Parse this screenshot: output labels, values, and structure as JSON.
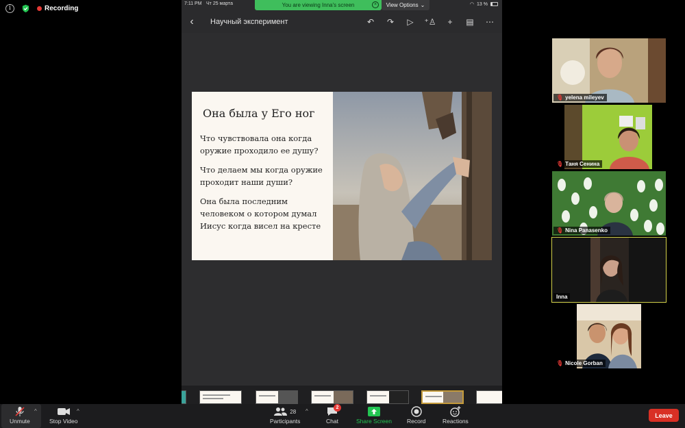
{
  "meeting": {
    "recording_label": "Recording",
    "info_icon": "info-icon",
    "security_icon": "shield-check-icon"
  },
  "shared_screen": {
    "status": {
      "time": "7:11 PM",
      "date": "Чт 25 марта",
      "battery": "13 %"
    },
    "banner_text": "You are viewing Inna's screen",
    "view_options_label": "View Options",
    "doc_title": "Научный эксперимент",
    "tools": [
      "undo-icon",
      "redo-icon",
      "play-icon",
      "add-person-icon",
      "plus-icon",
      "comment-icon",
      "more-icon"
    ],
    "slide": {
      "title": "Она была у Его ног",
      "paragraphs": [
        "Что чувствовала она когда оружие проходило ее душу?",
        "Что делаем мы когда оружие проходит наши души?",
        "Она была последним человеком о котором думал Иисус когда висел на кресте"
      ]
    },
    "thumbnail_count": 6
  },
  "participants": [
    {
      "name": "yelena mileyev",
      "muted": true,
      "active": false
    },
    {
      "name": "Таня Сенина",
      "muted": true,
      "active": false
    },
    {
      "name": "Nina Panasenko",
      "muted": true,
      "active": false
    },
    {
      "name": "Inna",
      "muted": false,
      "active": true
    },
    {
      "name": "Nicole Gorban",
      "muted": true,
      "active": false
    }
  ],
  "toolbar": {
    "unmute_label": "Unmute",
    "stop_video_label": "Stop Video",
    "participants_label": "Participants",
    "participants_count": "28",
    "chat_label": "Chat",
    "chat_badge": "2",
    "share_screen_label": "Share Screen",
    "record_label": "Record",
    "reactions_label": "Reactions",
    "leave_label": "Leave",
    "colors": {
      "share": "#23c552",
      "leave": "#d93025",
      "active_speaker": "#d4d24a"
    }
  }
}
